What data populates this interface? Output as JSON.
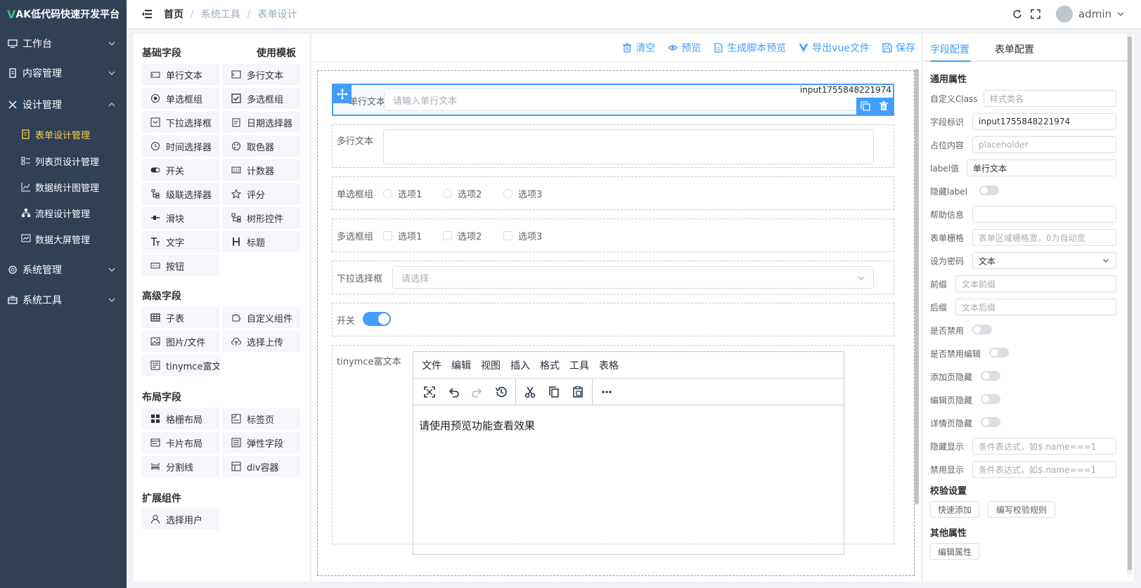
{
  "app": {
    "logo_prefix": "V",
    "logo_text": "AK低代码快速开发平台"
  },
  "sidebar": {
    "groups": [
      {
        "label": "工作台",
        "icon": "monitor-icon"
      },
      {
        "label": "内容管理",
        "icon": "document-icon"
      },
      {
        "label": "设计管理",
        "icon": "tools-icon",
        "expanded": true
      },
      {
        "label": "系统管理",
        "icon": "gear-icon"
      },
      {
        "label": "系统工具",
        "icon": "toolbox-icon"
      }
    ],
    "design_items": [
      {
        "label": "表单设计管理",
        "icon": "form-edit-icon",
        "active": true
      },
      {
        "label": "列表页设计管理",
        "icon": "list-icon"
      },
      {
        "label": "数据统计图管理",
        "icon": "line-chart-icon"
      },
      {
        "label": "流程设计管理",
        "icon": "flow-icon"
      },
      {
        "label": "数据大屏管理",
        "icon": "screen-chart-icon"
      }
    ]
  },
  "navbar": {
    "breadcrumbs": [
      "首页",
      "系统工具",
      "表单设计"
    ],
    "user": "admin"
  },
  "palette": {
    "basic_title": "基础字段",
    "template_link": "使用模板",
    "basic": [
      "单行文本",
      "多行文本",
      "单选框组",
      "多选框组",
      "下拉选择框",
      "日期选择器",
      "时间选择器",
      "取色器",
      "开关",
      "计数器",
      "级联选择器",
      "评分",
      "滑块",
      "树形控件",
      "文字",
      "标题",
      "按钮"
    ],
    "advanced_title": "高级字段",
    "advanced": [
      "子表",
      "自定义组件",
      "图片/文件",
      "选择上传",
      "tinymce富文本"
    ],
    "layout_title": "布局字段",
    "layout": [
      "格栅布局",
      "标签页",
      "卡片布局",
      "弹性字段",
      "分割线",
      "div容器"
    ],
    "ext_title": "扩展组件",
    "ext": [
      "选择用户"
    ]
  },
  "toolbar": {
    "clear": "清空",
    "preview": "预览",
    "script_preview": "生成脚本预览",
    "export_vue": "导出vue文件",
    "save": "保存"
  },
  "canvas": {
    "input": {
      "label": "单行文本",
      "placeholder": "请输入单行文本",
      "field_id": "input1755848221974"
    },
    "textarea": {
      "label": "多行文本"
    },
    "radio": {
      "label": "单选框组",
      "options": [
        "选项1",
        "选项2",
        "选项3"
      ]
    },
    "checkbox": {
      "label": "多选框组",
      "options": [
        "选项1",
        "选项2",
        "选项3"
      ]
    },
    "select": {
      "label": "下拉选择框",
      "placeholder": "请选择"
    },
    "switch": {
      "label": "开关",
      "on": true
    },
    "tinymce": {
      "label": "tinymce富文本",
      "menu": [
        "文件",
        "编辑",
        "视图",
        "插入",
        "格式",
        "工具",
        "表格"
      ],
      "content": "请使用预览功能查看效果"
    }
  },
  "props": {
    "tabs": [
      "字段配置",
      "表单配置"
    ],
    "general_title": "通用属性",
    "rows": {
      "custom_class": {
        "label": "自定义Class",
        "placeholder": "样式类名"
      },
      "field_key": {
        "label": "字段标识",
        "value": "input1755848221974"
      },
      "placeholder": {
        "label": "占位内容",
        "placeholder": "placeholder"
      },
      "label_value": {
        "label": "label值",
        "value": "单行文本"
      },
      "hide_label": {
        "label": "隐藏label"
      },
      "help": {
        "label": "帮助信息"
      },
      "grid": {
        "label": "表单栅格",
        "placeholder": "表单区域栅格宽，0为自动宽"
      },
      "password": {
        "label": "设为密码",
        "value": "文本"
      },
      "prefix": {
        "label": "前缀",
        "placeholder": "文本前缀"
      },
      "suffix": {
        "label": "后缀",
        "placeholder": "文本后缀"
      },
      "disabled": {
        "label": "是否禁用"
      },
      "edit_disabled": {
        "label": "是否禁用编辑"
      },
      "add_hidden": {
        "label": "添加页隐藏"
      },
      "edit_hidden": {
        "label": "编辑页隐藏"
      },
      "detail_hidden": {
        "label": "详情页隐藏"
      },
      "hide_show": {
        "label": "隐藏显示",
        "placeholder": "条件表达式，如$.name===1"
      },
      "disable_show": {
        "label": "禁用显示",
        "placeholder": "条件表达式，如$.name===1"
      }
    },
    "validation_title": "校验设置",
    "quick_add": "快速添加",
    "edit_rules": "编写校验规则",
    "other_title": "其他属性",
    "edit_attrs": "编辑属性"
  },
  "colors": {
    "primary": "#409eff",
    "sidebar_bg": "#304156",
    "active_menu": "#ffd04b"
  }
}
